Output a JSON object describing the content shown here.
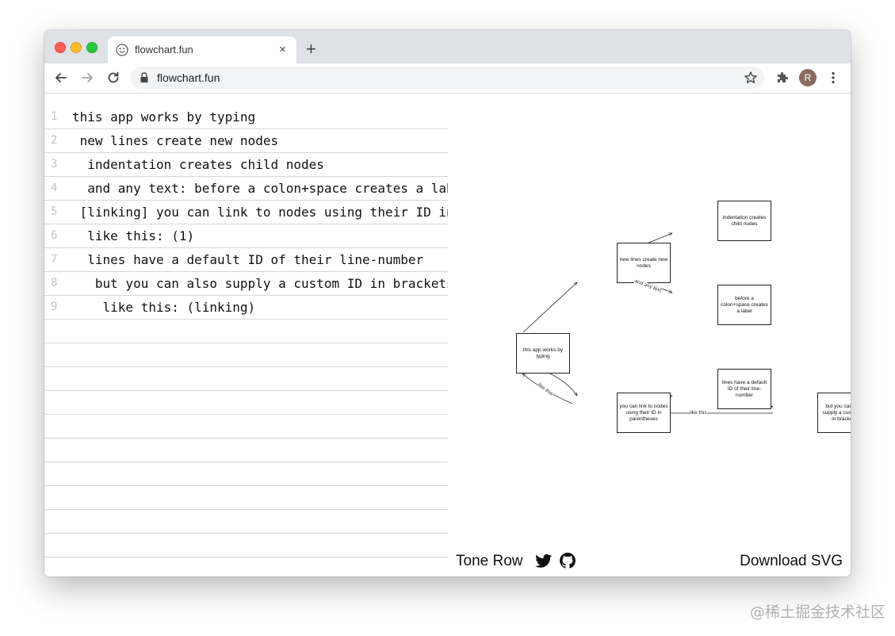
{
  "browser": {
    "tab_title": "flowchart.fun",
    "new_tab_symbol": "+",
    "close_symbol": "×",
    "url": "flowchart.fun",
    "profile_initial": "R"
  },
  "editor": {
    "lines": [
      {
        "num": "1",
        "text": "this app works by typing"
      },
      {
        "num": "2",
        "text": " new lines create new nodes"
      },
      {
        "num": "3",
        "text": "  indentation creates child nodes"
      },
      {
        "num": "4",
        "text": "  and any text: before a colon+space creates a label"
      },
      {
        "num": "5",
        "text": " [linking] you can link to nodes using their ID in parentheses"
      },
      {
        "num": "6",
        "text": "  like this: (1)"
      },
      {
        "num": "7",
        "text": "  lines have a default ID of their line-number"
      },
      {
        "num": "8",
        "text": "   but you can also supply a custom ID in brackets"
      },
      {
        "num": "9",
        "text": "    like this: (linking)"
      }
    ],
    "empty_rows": 10
  },
  "flowchart": {
    "nodes": [
      {
        "id": "n1",
        "label": "this app works by typing"
      },
      {
        "id": "n2",
        "label": "new lines create new nodes"
      },
      {
        "id": "n3",
        "label": "indentation creates child nodes"
      },
      {
        "id": "n4",
        "label": "before a colon+space creates a label"
      },
      {
        "id": "n5",
        "label": "you can link to nodes using their ID in parentheses"
      },
      {
        "id": "n7",
        "label": "lines have a default ID of their line-number"
      },
      {
        "id": "n8",
        "label": "but you can also supply a custom ID in brackets"
      }
    ],
    "edge_labels": {
      "and_any_text": "and any text",
      "like_this_1": "like this",
      "like_this_2": "like this"
    }
  },
  "footer": {
    "brand": "Tone Row",
    "download": "Download SVG"
  },
  "watermark": "@稀土掘金技术社区"
}
